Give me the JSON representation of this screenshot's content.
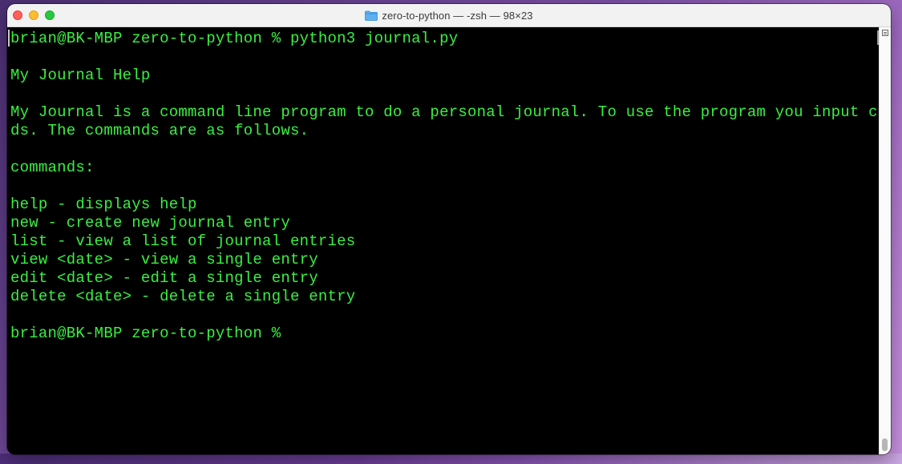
{
  "window": {
    "title": "zero-to-python — -zsh — 98×23"
  },
  "terminal": {
    "text_color": "#39f041",
    "background": "#000000",
    "lines": [
      "brian@BK-MBP zero-to-python % python3 journal.py",
      "",
      "My Journal Help",
      "",
      "My Journal is a command line program to do a personal journal. To use the program you input comman",
      "ds. The commands are as follows.",
      "",
      "commands:",
      "",
      "help - displays help",
      "new - create new journal entry",
      "list - view a list of journal entries",
      "view <date> - view a single entry",
      "edit <date> - edit a single entry",
      "delete <date> - delete a single entry",
      "",
      "brian@BK-MBP zero-to-python %"
    ]
  },
  "icons": {
    "folder": "folder-icon",
    "split": "split-view-icon"
  }
}
